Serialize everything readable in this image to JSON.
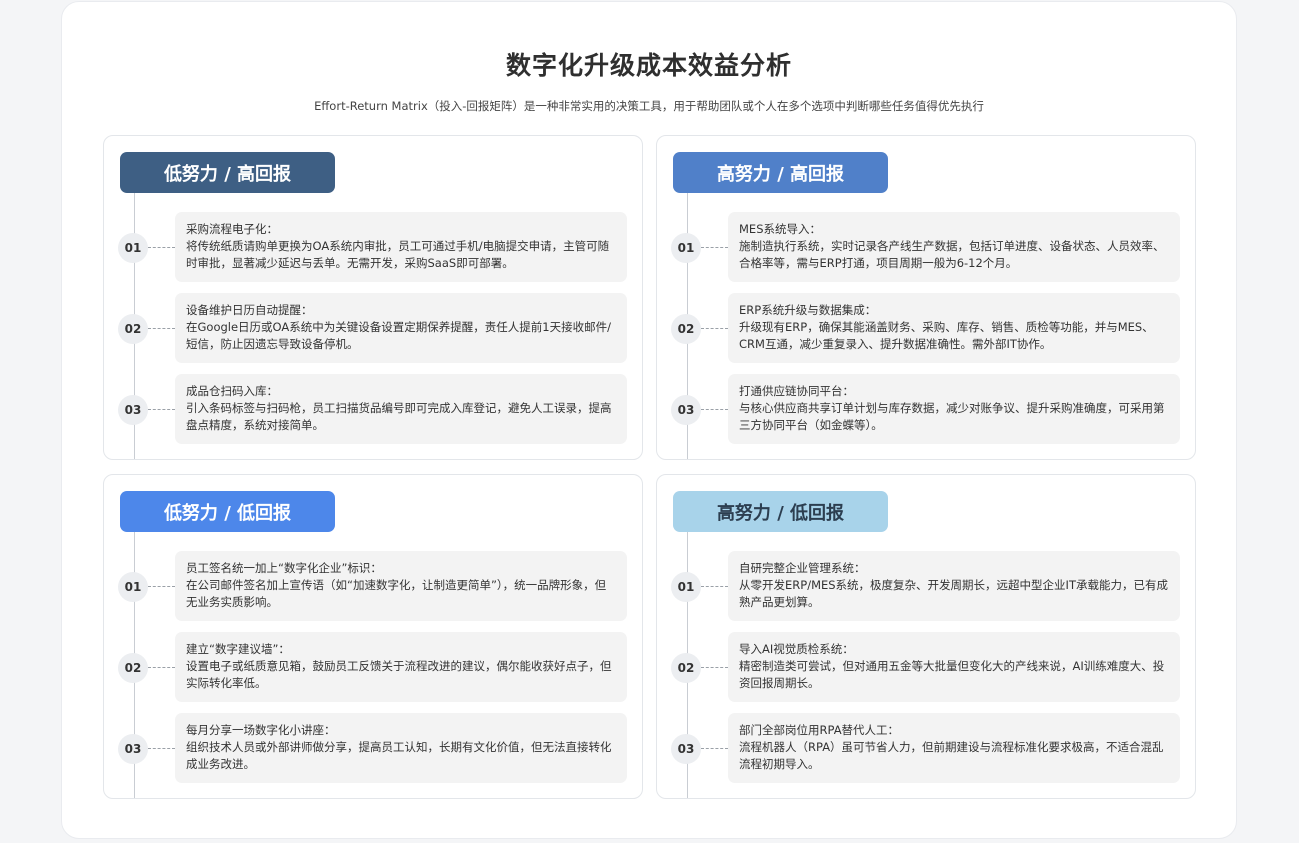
{
  "title": "数字化升级成本效益分析",
  "subtitle": "Effort-Return Matrix（投入-回报矩阵）是一种非常实用的决策工具，用于帮助团队或个人在多个选项中判断哪些任务值得优先执行",
  "colors": {
    "q1_header": "#3e5f84",
    "q2_header": "#5080c9",
    "q3_header": "#4d87ea",
    "q4_header": "#a8d3ea",
    "q4_header_text": "#2c3e50"
  },
  "quadrants": [
    {
      "label": "低努力 / 高回报",
      "items": [
        {
          "num": "01",
          "head": "采购流程电子化：",
          "body": "将传统纸质请购单更换为OA系统内审批，员工可通过手机/电脑提交申请，主管可随时审批，显著减少延迟与丢单。无需开发，采购SaaS即可部署。"
        },
        {
          "num": "02",
          "head": "设备维护日历自动提醒：",
          "body": "在Google日历或OA系统中为关键设备设置定期保养提醒，责任人提前1天接收邮件/短信，防止因遗忘导致设备停机。"
        },
        {
          "num": "03",
          "head": "成品仓扫码入库：",
          "body": "引入条码标签与扫码枪，员工扫描货品编号即可完成入库登记，避免人工误录，提高盘点精度，系统对接简单。"
        }
      ]
    },
    {
      "label": "高努力 / 高回报",
      "items": [
        {
          "num": "01",
          "head": "MES系统导入：",
          "body": "施制造执行系统，实时记录各产线生产数据，包括订单进度、设备状态、人员效率、合格率等，需与ERP打通，项目周期一般为6-12个月。"
        },
        {
          "num": "02",
          "head": "ERP系统升级与数据集成：",
          "body": "升级现有ERP，确保其能涵盖财务、采购、库存、销售、质检等功能，并与MES、CRM互通，减少重复录入、提升数据准确性。需外部IT协作。"
        },
        {
          "num": "03",
          "head": "打通供应链协同平台：",
          "body": "与核心供应商共享订单计划与库存数据，减少对账争议、提升采购准确度，可采用第三方协同平台（如金蝶等）。"
        }
      ]
    },
    {
      "label": "低努力 / 低回报",
      "items": [
        {
          "num": "01",
          "head": "员工签名统一加上“数字化企业”标识：",
          "body": "在公司邮件签名加上宣传语（如“加速数字化，让制造更简单”），统一品牌形象，但无业务实质影响。"
        },
        {
          "num": "02",
          "head": "建立“数字建议墙”：",
          "body": "设置电子或纸质意见箱，鼓励员工反馈关于流程改进的建议，偶尔能收获好点子，但实际转化率低。"
        },
        {
          "num": "03",
          "head": "每月分享一场数字化小讲座：",
          "body": "组织技术人员或外部讲师做分享，提高员工认知，长期有文化价值，但无法直接转化成业务改进。"
        }
      ]
    },
    {
      "label": "高努力 / 低回报",
      "items": [
        {
          "num": "01",
          "head": "自研完整企业管理系统：",
          "body": "从零开发ERP/MES系统，极度复杂、开发周期长，远超中型企业IT承载能力，已有成熟产品更划算。"
        },
        {
          "num": "02",
          "head": "导入AI视觉质检系统：",
          "body": "精密制造类可尝试，但对通用五金等大批量但变化大的产线来说，AI训练难度大、投资回报周期长。"
        },
        {
          "num": "03",
          "head": "部门全部岗位用RPA替代人工：",
          "body": "流程机器人（RPA）虽可节省人力，但前期建设与流程标准化要求极高，不适合混乱流程初期导入。"
        }
      ]
    }
  ]
}
